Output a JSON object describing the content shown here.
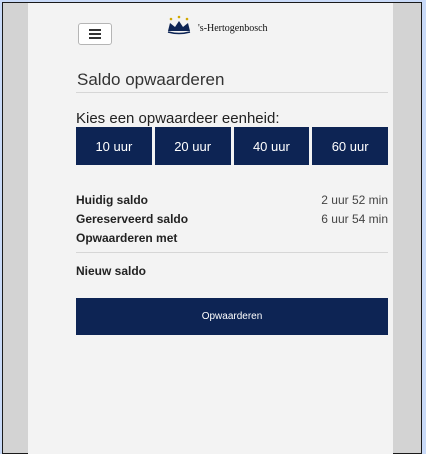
{
  "header": {
    "logo_text": "'s-Hertogenbosch"
  },
  "page": {
    "title": "Saldo opwaarderen",
    "subtitle": "Kies een opwaardeer eenheid:"
  },
  "units": [
    "10 uur",
    "20 uur",
    "40 uur",
    "60 uur"
  ],
  "balance": {
    "current_label": "Huidig saldo",
    "current_value": "2 uur 52 min",
    "reserved_label": "Gereserveerd saldo",
    "reserved_value": "6 uur 54 min",
    "topup_label": "Opwaarderen met",
    "new_label": "Nieuw saldo"
  },
  "actions": {
    "submit_label": "Opwaarderen"
  },
  "colors": {
    "primary": "#0d2454",
    "background": "#c9daf8",
    "panel": "#f3f3f3"
  }
}
